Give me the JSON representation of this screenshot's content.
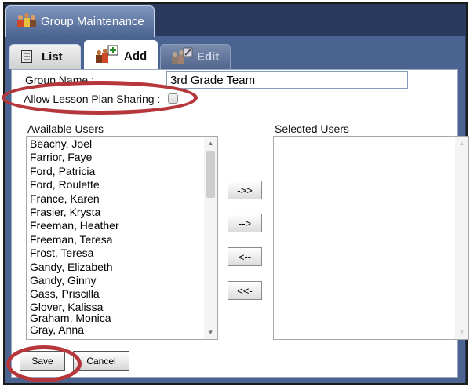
{
  "window": {
    "title": "Group Maintenance"
  },
  "tabs": [
    {
      "label": "List",
      "icon": "list-icon"
    },
    {
      "label": "Add",
      "icon": "group-add-icon"
    },
    {
      "label": "Edit",
      "icon": "group-edit-icon"
    }
  ],
  "form": {
    "group_name_label": "Group Name :",
    "group_name_value": "3rd Grade Team",
    "allow_sharing_label": "Allow Lesson Plan Sharing :",
    "allow_sharing_checked": false
  },
  "available_users": {
    "label": "Available Users",
    "items": [
      "Beachy, Joel",
      "Farrior, Faye",
      "Ford, Patricia",
      "Ford, Roulette",
      "France, Karen",
      "Frasier, Krysta",
      "Freeman, Heather",
      "Freeman, Teresa",
      "Frost, Teresa",
      "Gandy, Elizabeth",
      "Gandy, Ginny",
      "Gass, Priscilla",
      "Glover, Kalissa",
      "Graham, Monica",
      "Gray, Anna"
    ]
  },
  "selected_users": {
    "label": "Selected Users",
    "items": []
  },
  "move_buttons": {
    "add_all": "->>",
    "add": "-->",
    "remove": "<--",
    "remove_all": "<<-"
  },
  "actions": {
    "save": "Save",
    "cancel": "Cancel"
  },
  "colors": {
    "background": "#4b6390",
    "annotation": "#b5373c"
  }
}
